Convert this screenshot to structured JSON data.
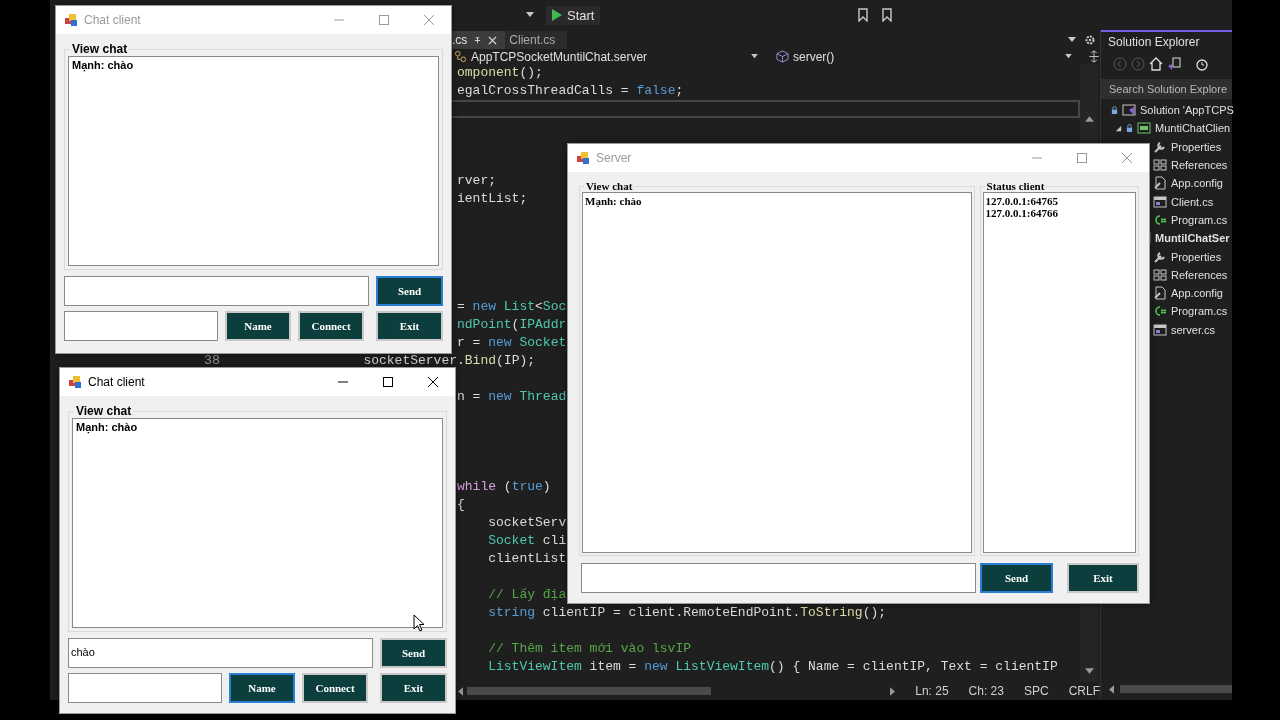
{
  "ide": {
    "toolbar": {
      "start_button": "Start"
    },
    "tabs": [
      {
        "label": ".cs",
        "selected": true
      },
      {
        "label": "Client.cs",
        "selected": false
      }
    ],
    "navigation": {
      "type_selector": "AppTCPSocketMuntilChat.server",
      "member_selector": "server()"
    },
    "code_lines": [
      {
        "kind": "body",
        "current": false,
        "tokens": [
          {
            "text": "omponent",
            "kind": "method"
          },
          {
            "text": "();",
            "kind": "plain"
          }
        ]
      },
      {
        "kind": "body",
        "current": false,
        "tokens": [
          {
            "text": "egalCrossThreadCalls = ",
            "kind": "plain"
          },
          {
            "text": "false",
            "kind": "keyword"
          },
          {
            "text": ";",
            "kind": "plain"
          }
        ]
      },
      {
        "kind": "blank",
        "current": true
      },
      {
        "kind": "blank",
        "current": false
      },
      {
        "kind": "blank",
        "current": false
      },
      {
        "kind": "blank",
        "current": false
      },
      {
        "kind": "body",
        "current": false,
        "tokens": [
          {
            "text": "rver;",
            "kind": "plain"
          }
        ]
      },
      {
        "kind": "body",
        "current": false,
        "tokens": [
          {
            "text": "ientList;",
            "kind": "plain"
          }
        ]
      },
      {
        "kind": "blank",
        "current": false
      },
      {
        "kind": "blank",
        "current": false
      },
      {
        "kind": "blank",
        "current": false
      },
      {
        "kind": "blank",
        "current": false
      },
      {
        "kind": "blank",
        "current": false
      },
      {
        "kind": "body",
        "current": false,
        "tokens": [
          {
            "text": "= ",
            "kind": "plain"
          },
          {
            "text": "new",
            "kind": "keyword"
          },
          {
            "text": " List",
            "kind": "type"
          },
          {
            "text": "<",
            "kind": "plain"
          },
          {
            "text": "Soc",
            "kind": "type"
          }
        ]
      },
      {
        "kind": "body",
        "current": false,
        "tokens": [
          {
            "text": "ndPoint",
            "kind": "type"
          },
          {
            "text": "(",
            "kind": "plain"
          },
          {
            "text": "IPAddr",
            "kind": "type"
          }
        ]
      },
      {
        "kind": "body",
        "current": false,
        "tokens": [
          {
            "text": "r = ",
            "kind": "plain"
          },
          {
            "text": "new",
            "kind": "keyword"
          },
          {
            "text": " Socket",
            "kind": "type"
          }
        ]
      },
      {
        "kind": "outer",
        "current": false,
        "number": "38",
        "tokens": [
          {
            "text": "socketServer.",
            "kind": "plain"
          },
          {
            "text": "Bind",
            "kind": "method"
          },
          {
            "text": "(IP);",
            "kind": "plain"
          }
        ]
      },
      {
        "kind": "blank",
        "current": false
      },
      {
        "kind": "body",
        "current": false,
        "tokens": [
          {
            "text": "n = ",
            "kind": "plain"
          },
          {
            "text": "new",
            "kind": "keyword"
          },
          {
            "text": " Thread",
            "kind": "type"
          }
        ]
      },
      {
        "kind": "blank",
        "current": false
      },
      {
        "kind": "blank",
        "current": false
      },
      {
        "kind": "blank",
        "current": false
      },
      {
        "kind": "blank",
        "current": false
      },
      {
        "kind": "body",
        "current": false,
        "tokens": [
          {
            "text": "while",
            "kind": "control"
          },
          {
            "text": " (",
            "kind": "plain"
          },
          {
            "text": "true",
            "kind": "keyword"
          },
          {
            "text": ")",
            "kind": "plain"
          }
        ]
      },
      {
        "kind": "body",
        "current": false,
        "tokens": [
          {
            "text": "{",
            "kind": "plain"
          }
        ]
      },
      {
        "kind": "inner",
        "current": false,
        "tokens": [
          {
            "text": "socketServ",
            "kind": "plain"
          }
        ]
      },
      {
        "kind": "inner",
        "current": false,
        "tokens": [
          {
            "text": "Socket",
            "kind": "type"
          },
          {
            "text": " cli",
            "kind": "plain"
          }
        ]
      },
      {
        "kind": "inner",
        "current": false,
        "tokens": [
          {
            "text": "clientList",
            "kind": "plain"
          }
        ]
      },
      {
        "kind": "blank",
        "current": false
      },
      {
        "kind": "inner",
        "current": false,
        "tokens": [
          {
            "text": "// Lấy địa",
            "kind": "comment"
          }
        ]
      },
      {
        "kind": "inner",
        "current": false,
        "tokens": [
          {
            "text": "string",
            "kind": "keyword"
          },
          {
            "text": " clientIP = client.RemoteEndPoint.",
            "kind": "plain"
          },
          {
            "text": "ToString",
            "kind": "method"
          },
          {
            "text": "();",
            "kind": "plain"
          }
        ]
      },
      {
        "kind": "blank",
        "current": false
      },
      {
        "kind": "inner",
        "current": false,
        "tokens": [
          {
            "text": "// Thêm item mới vào lsvIP",
            "kind": "comment"
          }
        ]
      },
      {
        "kind": "inner",
        "current": false,
        "tokens": [
          {
            "text": "ListViewItem",
            "kind": "type"
          },
          {
            "text": " item = ",
            "kind": "plain"
          },
          {
            "text": "new",
            "kind": "keyword"
          },
          {
            "text": " ListViewItem",
            "kind": "type"
          },
          {
            "text": "() { Name = clientIP, Text = clientIP",
            "kind": "plain"
          }
        ]
      }
    ],
    "status": {
      "line": "Ln: 25",
      "column": "Ch: 23",
      "spacing": "SPC",
      "line_endings": "CRLF"
    }
  },
  "solution_explorer": {
    "title": "Solution Explorer",
    "search": {
      "placeholder": "Search Solution Explore"
    },
    "tree": [
      {
        "label": "Solution 'AppTCPS",
        "kind": "solution",
        "children": [
          {
            "label": "MuntiChatClien",
            "kind": "project",
            "startup": false,
            "expanded": true,
            "children": [
              {
                "label": "Properties",
                "kind": "properties"
              },
              {
                "label": "References",
                "kind": "references"
              },
              {
                "label": "App.config",
                "kind": "config"
              },
              {
                "label": "Client.cs",
                "kind": "form"
              },
              {
                "label": "Program.cs",
                "kind": "csharp"
              }
            ]
          },
          {
            "label": "MuntilChatSer",
            "kind": "project",
            "startup": true,
            "expanded": true,
            "children": [
              {
                "label": "Properties",
                "kind": "properties"
              },
              {
                "label": "References",
                "kind": "references"
              },
              {
                "label": "App.config",
                "kind": "config"
              },
              {
                "label": "Program.cs",
                "kind": "csharp"
              },
              {
                "label": "server.cs",
                "kind": "form"
              }
            ]
          }
        ]
      }
    ]
  },
  "windows": [
    {
      "kind": "client",
      "title": "Chat client",
      "active": false,
      "chat_label": "View chat",
      "messages": [
        "Mạnh: chào"
      ],
      "buttons": [
        {
          "label": "Send",
          "focused": true
        },
        {
          "label": "Name",
          "focused": false
        },
        {
          "label": "Connect",
          "focused": false
        },
        {
          "label": "Exit",
          "focused": false
        }
      ]
    },
    {
      "kind": "client",
      "title": "Chat client",
      "active": true,
      "chat_label": "View chat",
      "messages": [
        "Mạnh: chào"
      ],
      "message": {
        "value": "chào"
      },
      "buttons": [
        {
          "label": "Send",
          "focused": false
        },
        {
          "label": "Name",
          "focused": true
        },
        {
          "label": "Connect",
          "focused": false
        },
        {
          "label": "Exit",
          "focused": false
        }
      ]
    },
    {
      "kind": "server",
      "title": "Server",
      "active": false,
      "chat_label": "View chat",
      "messages": [
        "Mạnh: chào"
      ],
      "status_label": "Status client",
      "clients": [
        "127.0.0.1:64765",
        "127.0.0.1:64766"
      ],
      "buttons": [
        {
          "label": "Send",
          "focused": true
        },
        {
          "label": "Exit",
          "focused": false
        }
      ]
    }
  ]
}
